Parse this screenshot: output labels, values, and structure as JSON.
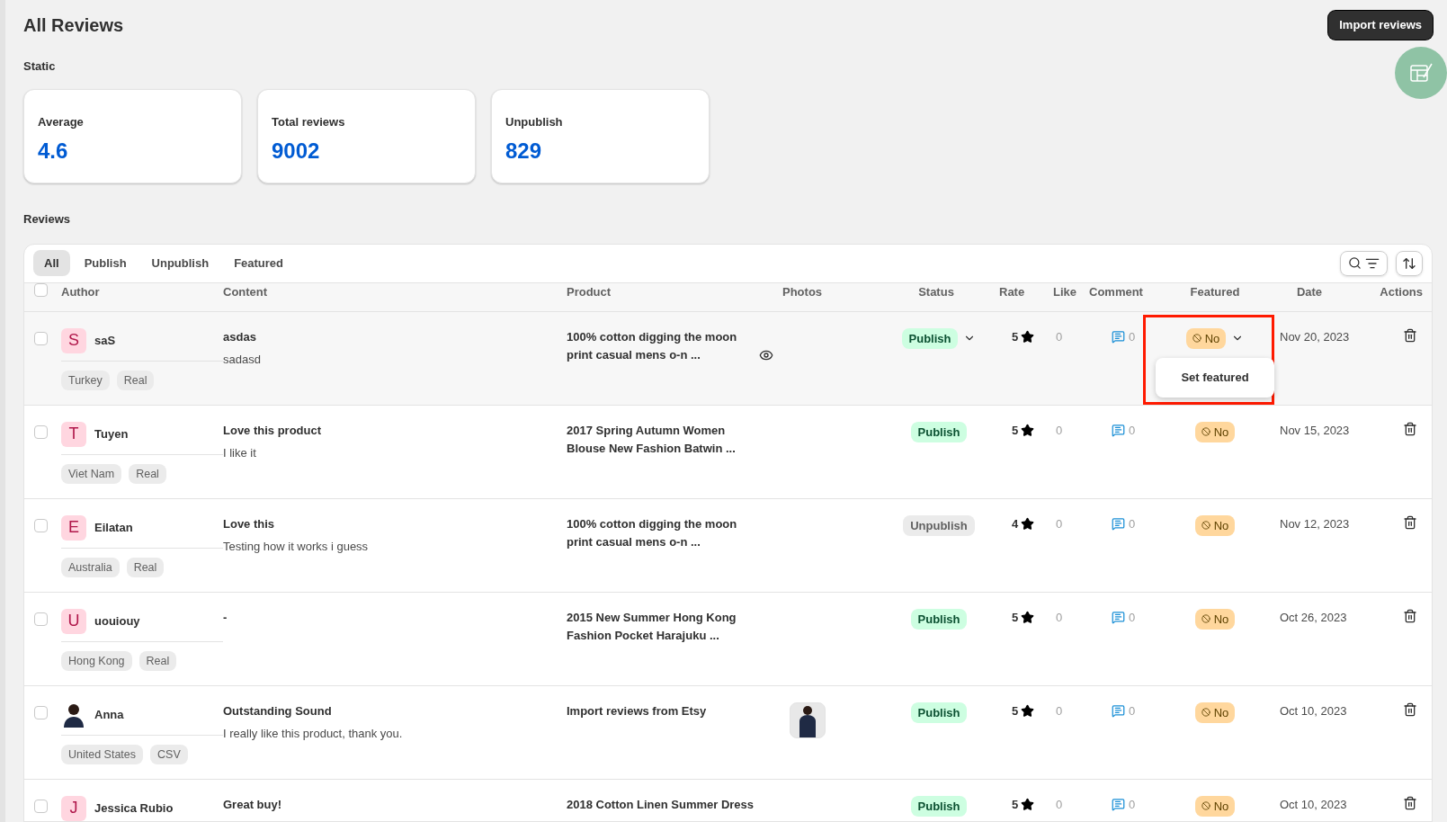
{
  "page": {
    "title": "All Reviews",
    "import_button": "Import reviews"
  },
  "stats_heading": "Static",
  "stats": [
    {
      "label": "Average",
      "value": "4.6"
    },
    {
      "label": "Total reviews",
      "value": "9002"
    },
    {
      "label": "Unpublish",
      "value": "829"
    }
  ],
  "reviews_heading": "Reviews",
  "tabs": [
    {
      "label": "All",
      "selected": true
    },
    {
      "label": "Publish",
      "selected": false
    },
    {
      "label": "Unpublish",
      "selected": false
    },
    {
      "label": "Featured",
      "selected": false
    }
  ],
  "table": {
    "all_checked": false,
    "columns": [
      "Author",
      "Content",
      "Product",
      "Photos",
      "Status",
      "Rate",
      "Like",
      "Comment",
      "Featured",
      "Date",
      "Actions"
    ],
    "rows": [
      {
        "selected": true,
        "checked": false,
        "avatar": {
          "kind": "letter",
          "initial": "S"
        },
        "author": "saS",
        "tags": [
          "Turkey",
          "Real"
        ],
        "title": "asdas",
        "body": "sadasd",
        "product": "100% cotton digging the moon print casual mens o-n ...",
        "preview": true,
        "photo": false,
        "status": {
          "label": "Publish",
          "kind": "publish"
        },
        "rate": "5",
        "like": "0",
        "comment": "0",
        "featured": "No",
        "featured_menu": [
          "Set featured"
        ],
        "highlighted": true,
        "date": "Nov 20, 2023"
      },
      {
        "selected": false,
        "checked": false,
        "avatar": {
          "kind": "letter",
          "initial": "T"
        },
        "author": "Tuyen",
        "tags": [
          "Viet Nam",
          "Real"
        ],
        "title": "Love this product",
        "body": "I like it",
        "product": "2017 Spring Autumn Women Blouse New Fashion Batwin ...",
        "preview": false,
        "photo": false,
        "status": {
          "label": "Publish",
          "kind": "publish"
        },
        "rate": "5",
        "like": "0",
        "comment": "0",
        "featured": "No",
        "highlighted": false,
        "date": "Nov 15, 2023"
      },
      {
        "selected": false,
        "checked": false,
        "avatar": {
          "kind": "letter",
          "initial": "E"
        },
        "author": "Eilatan",
        "tags": [
          "Australia",
          "Real"
        ],
        "title": "Love this",
        "body": "Testing how it works i guess",
        "product": "100% cotton digging the moon print casual mens o-n ...",
        "preview": false,
        "photo": false,
        "status": {
          "label": "Unpublish",
          "kind": "unpublish"
        },
        "rate": "4",
        "like": "0",
        "comment": "0",
        "featured": "No",
        "highlighted": false,
        "date": "Nov 12, 2023"
      },
      {
        "selected": false,
        "checked": false,
        "avatar": {
          "kind": "letter",
          "initial": "U"
        },
        "author": "uouiouy",
        "tags": [
          "Hong Kong",
          "Real"
        ],
        "title": "-",
        "product": "2015 New Summer Hong Kong Fashion Pocket Harajuku ...",
        "preview": false,
        "photo": false,
        "status": {
          "label": "Publish",
          "kind": "publish"
        },
        "rate": "5",
        "like": "0",
        "comment": "0",
        "featured": "No",
        "highlighted": false,
        "date": "Oct 26, 2023"
      },
      {
        "selected": false,
        "checked": false,
        "avatar": {
          "kind": "photo"
        },
        "author": "Anna",
        "tags": [
          "United States",
          "CSV"
        ],
        "title": "Outstanding Sound",
        "body": "I really like this product, thank you.",
        "product": "Import reviews from Etsy",
        "preview": false,
        "photo": true,
        "status": {
          "label": "Publish",
          "kind": "publish"
        },
        "rate": "5",
        "like": "0",
        "comment": "0",
        "featured": "No",
        "highlighted": false,
        "date": "Oct 10, 2023"
      },
      {
        "selected": false,
        "checked": false,
        "avatar": {
          "kind": "letter",
          "initial": "J"
        },
        "author": "Jessica Rubio",
        "title": "Great buy!",
        "product": "2018 Cotton Linen Summer Dress",
        "preview": false,
        "photo": false,
        "status": {
          "label": "Publish",
          "kind": "publish"
        },
        "rate": "5",
        "like": "0",
        "comment": "0",
        "featured": "No",
        "highlighted": false,
        "date": "Oct 10, 2023"
      }
    ]
  }
}
